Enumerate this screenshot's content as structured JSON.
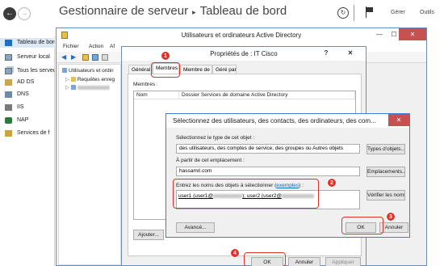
{
  "server_manager": {
    "title": "Gestionnaire de serveur",
    "crumb_separator": "▸",
    "page": "Tableau de bord",
    "menu": [
      "Gérer",
      "Outils"
    ],
    "nav": [
      {
        "label": "Tableau de bord",
        "icon": "dashboard-icon",
        "active": true
      },
      {
        "label": "Serveur local",
        "icon": "server-icon"
      },
      {
        "label": "Tous les serveurs",
        "icon": "servers-icon"
      },
      {
        "label": "AD DS",
        "icon": "ad-ds-icon"
      },
      {
        "label": "DNS",
        "icon": "dns-icon"
      },
      {
        "label": "IIS",
        "icon": "iis-icon"
      },
      {
        "label": "NAP",
        "icon": "nap-icon"
      },
      {
        "label": "Services de f",
        "icon": "file-services-icon"
      }
    ]
  },
  "aduc": {
    "title": "Utilisateurs et ordinateurs Active Directory",
    "menu": [
      "Fichier",
      "Action",
      "Af"
    ],
    "tree": [
      "Utilisateurs et ordin",
      "Requêtes enreg"
    ],
    "controls": {
      "minimize": "—",
      "maximize": "☐",
      "close": "✕"
    }
  },
  "properties": {
    "title": "Propriétés de : IT Cisco",
    "help": "?",
    "close": "✕",
    "tabs": [
      "Général",
      "Membres",
      "Membre de",
      "Géré par"
    ],
    "members_label": "Membres :",
    "columns": [
      "Nom",
      "Dossier Services de domaine Active Directory"
    ],
    "buttons": {
      "add": "Ajouter...",
      "ok": "OK",
      "cancel": "Annuler",
      "apply": "Appliquer"
    }
  },
  "select_dialog": {
    "title": "Sélectionnez des utilisateurs, des contacts, des ordinateurs, des com...",
    "close": "✕",
    "object_type_label": "Sélectionnez le type de cet objet :",
    "object_type_value": "des utilisateurs, des comptes de service, des groupes ou Autres objets",
    "object_types_button": "Types d'objets...",
    "location_label": "À partir de cet emplacement :",
    "location_value": "hassamri.com",
    "locations_button": "Emplacements...",
    "names_label_prefix": "Entrez les noms des objets à sélectionner (",
    "names_label_link": "exemples",
    "names_label_suffix": ") :",
    "names_value_1": "user1 (user1@",
    "names_value_2": "); user2 (user2@",
    "check_names_button": "Vérifier les noms",
    "advanced_button": "Avancé...",
    "ok_button": "OK",
    "cancel_button": "Annuler"
  },
  "steps": [
    "1",
    "2",
    "3",
    "4"
  ],
  "colors": {
    "accent": "#1c6ec7",
    "highlight": "#e0322a"
  }
}
